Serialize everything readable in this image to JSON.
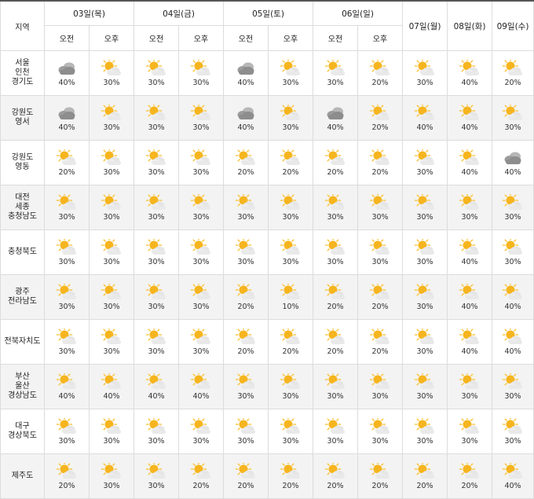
{
  "header": {
    "region_label": "지역",
    "days": [
      {
        "label": "03일(목)",
        "split": true
      },
      {
        "label": "04일(금)",
        "split": true
      },
      {
        "label": "05일(토)",
        "split": true
      },
      {
        "label": "06일(일)",
        "split": true
      },
      {
        "label": "07일(월)",
        "split": false
      },
      {
        "label": "08일(화)",
        "split": false
      },
      {
        "label": "09일(수)",
        "split": false
      }
    ],
    "am_label": "오전",
    "pm_label": "오후"
  },
  "rows": [
    {
      "region": [
        "서울",
        "인천",
        "경기도"
      ],
      "cells": [
        {
          "icon": "cloudy-icon",
          "pop": "40%"
        },
        {
          "icon": "partly-cloudy-icon",
          "pop": "30%"
        },
        {
          "icon": "partly-cloudy-icon",
          "pop": "30%"
        },
        {
          "icon": "partly-cloudy-icon",
          "pop": "30%"
        },
        {
          "icon": "cloudy-icon",
          "pop": "40%"
        },
        {
          "icon": "partly-cloudy-icon",
          "pop": "30%"
        },
        {
          "icon": "partly-cloudy-icon",
          "pop": "30%"
        },
        {
          "icon": "partly-cloudy-icon",
          "pop": "20%"
        },
        {
          "icon": "partly-cloudy-icon",
          "pop": "30%"
        },
        {
          "icon": "partly-cloudy-icon",
          "pop": "40%"
        },
        {
          "icon": "partly-cloudy-icon",
          "pop": "20%"
        }
      ]
    },
    {
      "region": [
        "강원도",
        "영서"
      ],
      "cells": [
        {
          "icon": "cloudy-icon",
          "pop": "40%"
        },
        {
          "icon": "partly-cloudy-icon",
          "pop": "30%"
        },
        {
          "icon": "partly-cloudy-icon",
          "pop": "30%"
        },
        {
          "icon": "partly-cloudy-icon",
          "pop": "30%"
        },
        {
          "icon": "cloudy-icon",
          "pop": "40%"
        },
        {
          "icon": "partly-cloudy-icon",
          "pop": "30%"
        },
        {
          "icon": "cloudy-icon",
          "pop": "40%"
        },
        {
          "icon": "partly-cloudy-icon",
          "pop": "20%"
        },
        {
          "icon": "partly-cloudy-icon",
          "pop": "40%"
        },
        {
          "icon": "partly-cloudy-icon",
          "pop": "40%"
        },
        {
          "icon": "partly-cloudy-icon",
          "pop": "30%"
        }
      ]
    },
    {
      "region": [
        "강원도",
        "영동"
      ],
      "cells": [
        {
          "icon": "partly-cloudy-icon",
          "pop": "20%"
        },
        {
          "icon": "partly-cloudy-icon",
          "pop": "30%"
        },
        {
          "icon": "partly-cloudy-icon",
          "pop": "30%"
        },
        {
          "icon": "partly-cloudy-icon",
          "pop": "30%"
        },
        {
          "icon": "partly-cloudy-icon",
          "pop": "20%"
        },
        {
          "icon": "partly-cloudy-icon",
          "pop": "20%"
        },
        {
          "icon": "partly-cloudy-icon",
          "pop": "20%"
        },
        {
          "icon": "partly-cloudy-icon",
          "pop": "20%"
        },
        {
          "icon": "partly-cloudy-icon",
          "pop": "30%"
        },
        {
          "icon": "partly-cloudy-icon",
          "pop": "40%"
        },
        {
          "icon": "cloudy-icon",
          "pop": "40%"
        }
      ]
    },
    {
      "region": [
        "대전",
        "세종",
        "충청남도"
      ],
      "cells": [
        {
          "icon": "partly-cloudy-icon",
          "pop": "30%"
        },
        {
          "icon": "partly-cloudy-icon",
          "pop": "30%"
        },
        {
          "icon": "partly-cloudy-icon",
          "pop": "30%"
        },
        {
          "icon": "partly-cloudy-icon",
          "pop": "30%"
        },
        {
          "icon": "partly-cloudy-icon",
          "pop": "30%"
        },
        {
          "icon": "partly-cloudy-icon",
          "pop": "30%"
        },
        {
          "icon": "partly-cloudy-icon",
          "pop": "30%"
        },
        {
          "icon": "partly-cloudy-icon",
          "pop": "30%"
        },
        {
          "icon": "partly-cloudy-icon",
          "pop": "30%"
        },
        {
          "icon": "partly-cloudy-icon",
          "pop": "30%"
        },
        {
          "icon": "partly-cloudy-icon",
          "pop": "30%"
        }
      ]
    },
    {
      "region": [
        "충청북도"
      ],
      "cells": [
        {
          "icon": "partly-cloudy-icon",
          "pop": "30%"
        },
        {
          "icon": "partly-cloudy-icon",
          "pop": "30%"
        },
        {
          "icon": "partly-cloudy-icon",
          "pop": "30%"
        },
        {
          "icon": "partly-cloudy-icon",
          "pop": "30%"
        },
        {
          "icon": "partly-cloudy-icon",
          "pop": "30%"
        },
        {
          "icon": "partly-cloudy-icon",
          "pop": "30%"
        },
        {
          "icon": "partly-cloudy-icon",
          "pop": "30%"
        },
        {
          "icon": "partly-cloudy-icon",
          "pop": "30%"
        },
        {
          "icon": "partly-cloudy-icon",
          "pop": "30%"
        },
        {
          "icon": "partly-cloudy-icon",
          "pop": "40%"
        },
        {
          "icon": "partly-cloudy-icon",
          "pop": "30%"
        }
      ]
    },
    {
      "region": [
        "광주",
        "전라남도"
      ],
      "cells": [
        {
          "icon": "partly-cloudy-icon",
          "pop": "30%"
        },
        {
          "icon": "partly-cloudy-icon",
          "pop": "30%"
        },
        {
          "icon": "partly-cloudy-icon",
          "pop": "30%"
        },
        {
          "icon": "partly-cloudy-icon",
          "pop": "30%"
        },
        {
          "icon": "partly-cloudy-icon",
          "pop": "20%"
        },
        {
          "icon": "partly-cloudy-icon",
          "pop": "10%"
        },
        {
          "icon": "partly-cloudy-icon",
          "pop": "20%"
        },
        {
          "icon": "partly-cloudy-icon",
          "pop": "20%"
        },
        {
          "icon": "partly-cloudy-icon",
          "pop": "30%"
        },
        {
          "icon": "partly-cloudy-icon",
          "pop": "40%"
        },
        {
          "icon": "partly-cloudy-icon",
          "pop": "40%"
        }
      ]
    },
    {
      "region": [
        "전북자치도"
      ],
      "cells": [
        {
          "icon": "partly-cloudy-icon",
          "pop": "30%"
        },
        {
          "icon": "partly-cloudy-icon",
          "pop": "30%"
        },
        {
          "icon": "partly-cloudy-icon",
          "pop": "30%"
        },
        {
          "icon": "partly-cloudy-icon",
          "pop": "30%"
        },
        {
          "icon": "partly-cloudy-icon",
          "pop": "20%"
        },
        {
          "icon": "partly-cloudy-icon",
          "pop": "20%"
        },
        {
          "icon": "partly-cloudy-icon",
          "pop": "20%"
        },
        {
          "icon": "partly-cloudy-icon",
          "pop": "20%"
        },
        {
          "icon": "partly-cloudy-icon",
          "pop": "30%"
        },
        {
          "icon": "partly-cloudy-icon",
          "pop": "40%"
        },
        {
          "icon": "partly-cloudy-icon",
          "pop": "40%"
        }
      ]
    },
    {
      "region": [
        "부산",
        "울산",
        "경상남도"
      ],
      "cells": [
        {
          "icon": "partly-cloudy-icon",
          "pop": "40%"
        },
        {
          "icon": "partly-cloudy-icon",
          "pop": "40%"
        },
        {
          "icon": "partly-cloudy-icon",
          "pop": "40%"
        },
        {
          "icon": "partly-cloudy-icon",
          "pop": "40%"
        },
        {
          "icon": "partly-cloudy-icon",
          "pop": "30%"
        },
        {
          "icon": "partly-cloudy-icon",
          "pop": "30%"
        },
        {
          "icon": "partly-cloudy-icon",
          "pop": "30%"
        },
        {
          "icon": "partly-cloudy-icon",
          "pop": "30%"
        },
        {
          "icon": "partly-cloudy-icon",
          "pop": "30%"
        },
        {
          "icon": "partly-cloudy-icon",
          "pop": "30%"
        },
        {
          "icon": "partly-cloudy-icon",
          "pop": "30%"
        }
      ]
    },
    {
      "region": [
        "대구",
        "경상북도"
      ],
      "cells": [
        {
          "icon": "partly-cloudy-icon",
          "pop": "30%"
        },
        {
          "icon": "partly-cloudy-icon",
          "pop": "30%"
        },
        {
          "icon": "partly-cloudy-icon",
          "pop": "30%"
        },
        {
          "icon": "partly-cloudy-icon",
          "pop": "30%"
        },
        {
          "icon": "partly-cloudy-icon",
          "pop": "30%"
        },
        {
          "icon": "partly-cloudy-icon",
          "pop": "30%"
        },
        {
          "icon": "partly-cloudy-icon",
          "pop": "30%"
        },
        {
          "icon": "partly-cloudy-icon",
          "pop": "30%"
        },
        {
          "icon": "partly-cloudy-icon",
          "pop": "30%"
        },
        {
          "icon": "partly-cloudy-icon",
          "pop": "30%"
        },
        {
          "icon": "partly-cloudy-icon",
          "pop": "30%"
        }
      ]
    },
    {
      "region": [
        "제주도"
      ],
      "cells": [
        {
          "icon": "partly-cloudy-icon",
          "pop": "20%"
        },
        {
          "icon": "partly-cloudy-icon",
          "pop": "30%"
        },
        {
          "icon": "partly-cloudy-icon",
          "pop": "30%"
        },
        {
          "icon": "partly-cloudy-icon",
          "pop": "20%"
        },
        {
          "icon": "partly-cloudy-icon",
          "pop": "20%"
        },
        {
          "icon": "partly-cloudy-icon",
          "pop": "20%"
        },
        {
          "icon": "partly-cloudy-icon",
          "pop": "20%"
        },
        {
          "icon": "partly-cloudy-icon",
          "pop": "20%"
        },
        {
          "icon": "partly-cloudy-icon",
          "pop": "20%"
        },
        {
          "icon": "partly-cloudy-icon",
          "pop": "20%"
        },
        {
          "icon": "partly-cloudy-icon",
          "pop": "40%"
        }
      ]
    }
  ],
  "colors": {
    "sun": "#f6b51e",
    "sun_ray": "#f9c84a",
    "cloud_light": "#eeeeee",
    "cloud_dark": "#9c9c9c",
    "row_shade": "#f3f3f3",
    "border": "#dcdcdc"
  }
}
